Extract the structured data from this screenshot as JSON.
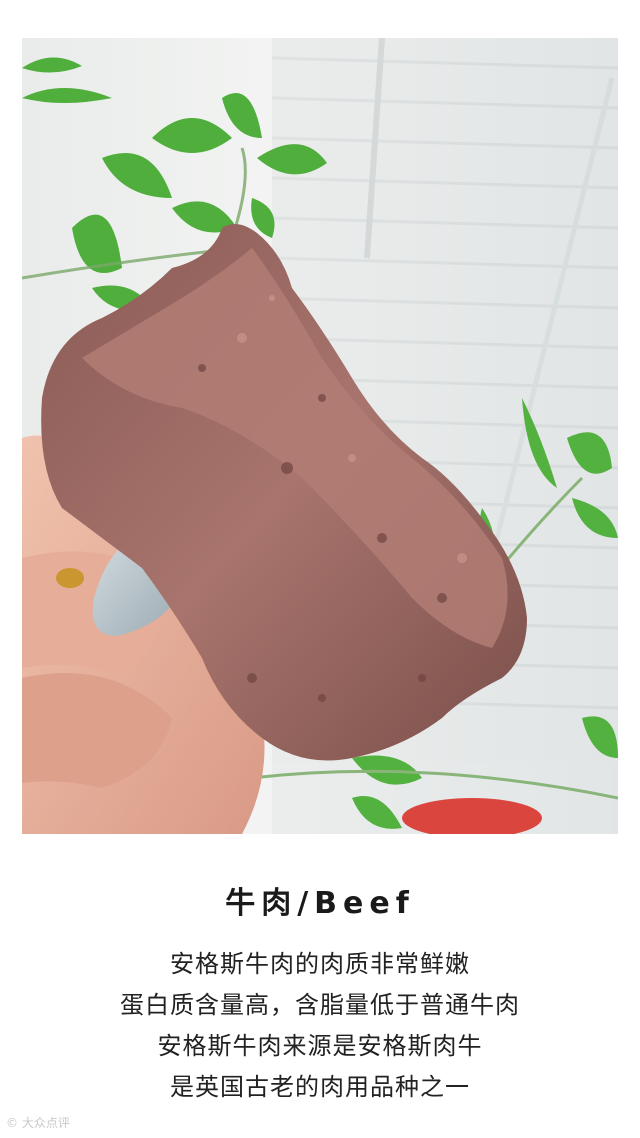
{
  "post": {
    "title": "牛肉/Beef",
    "lines": [
      "安格斯牛肉的肉质非常鲜嫩",
      "蛋白质含量高，含脂量低于普通牛肉",
      "安格斯牛肉来源是安格斯肉牛",
      "是英国古老的肉用品种之一"
    ],
    "watermark": "© 大众点评"
  },
  "photo": {
    "subject": "hand-holding-beef-slice",
    "colors": {
      "background": "#eef0ef",
      "meat": "#9c6a64",
      "meat_dark": "#7a4d48",
      "leaf": "#4caf3a",
      "nail": "#b8c6cc",
      "skin": "#e8b5a0"
    }
  }
}
